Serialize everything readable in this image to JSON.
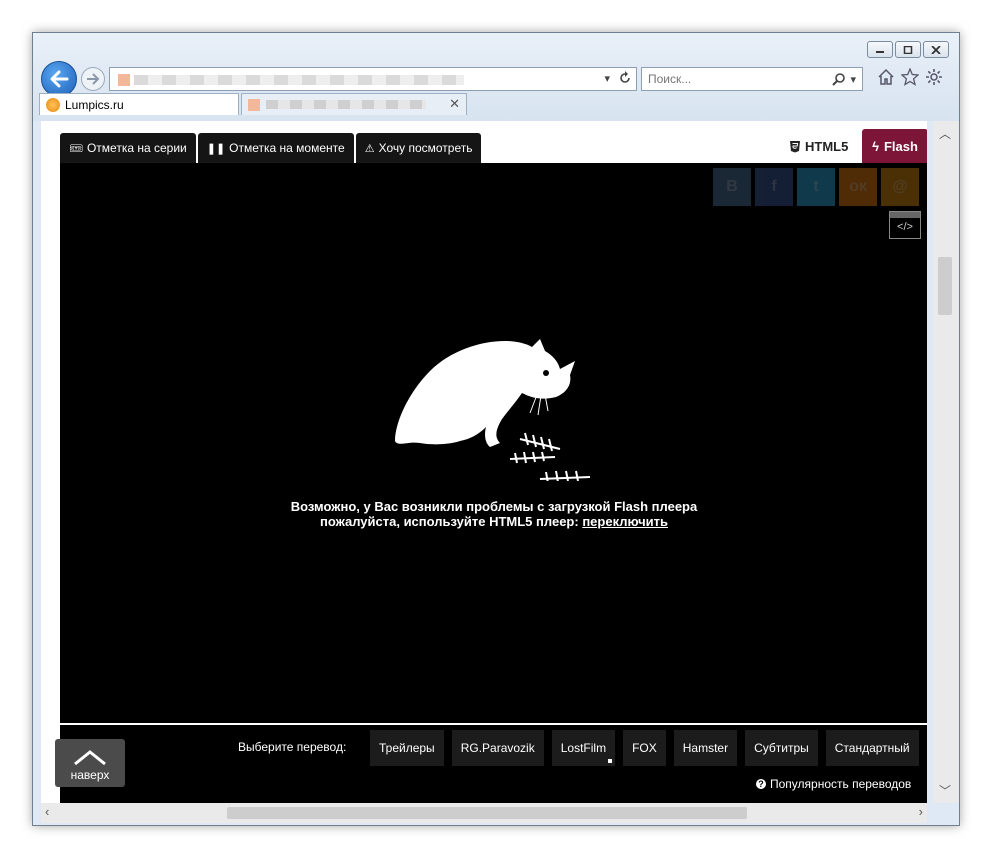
{
  "browser": {
    "search_placeholder": "Поиск...",
    "tabs": [
      {
        "label": "Lumpics.ru"
      },
      {
        "label": ""
      }
    ]
  },
  "player": {
    "tabs": [
      {
        "label": "Отметка на серии",
        "icon": "ticket-icon"
      },
      {
        "label": "Отметка на моменте",
        "icon": "pause-icon"
      },
      {
        "label": "Хочу посмотреть",
        "icon": "warning-icon"
      }
    ],
    "html5_label": "HTML5",
    "flash_label": "Flash",
    "social": [
      {
        "name": "vk-icon",
        "glyph": "В",
        "color": "#4a6f96"
      },
      {
        "name": "facebook-icon",
        "glyph": "f",
        "color": "#3b5b98"
      },
      {
        "name": "twitter-icon",
        "glyph": "t",
        "color": "#2fa7d8"
      },
      {
        "name": "odnoklassniki-icon",
        "glyph": "ок",
        "color": "#e27b12"
      },
      {
        "name": "mail-icon",
        "glyph": "@",
        "color": "#d8860f"
      }
    ],
    "embed_label": "</>",
    "message_line1": "Возможно, у Вас возникли проблемы с загрузкой Flash плеера",
    "message_line2": "пожалуйста, используйте HTML5 плеер: ",
    "message_link": "переключить",
    "translation_label": "Выберите перевод:",
    "translations": [
      "Трейлеры",
      "RG.Paravozik",
      "LostFilm",
      "FOX",
      "Hamster",
      "Субтитры",
      "Стандартный"
    ],
    "popularity_label": "Популярность переводов",
    "to_top_label": "наверх"
  }
}
